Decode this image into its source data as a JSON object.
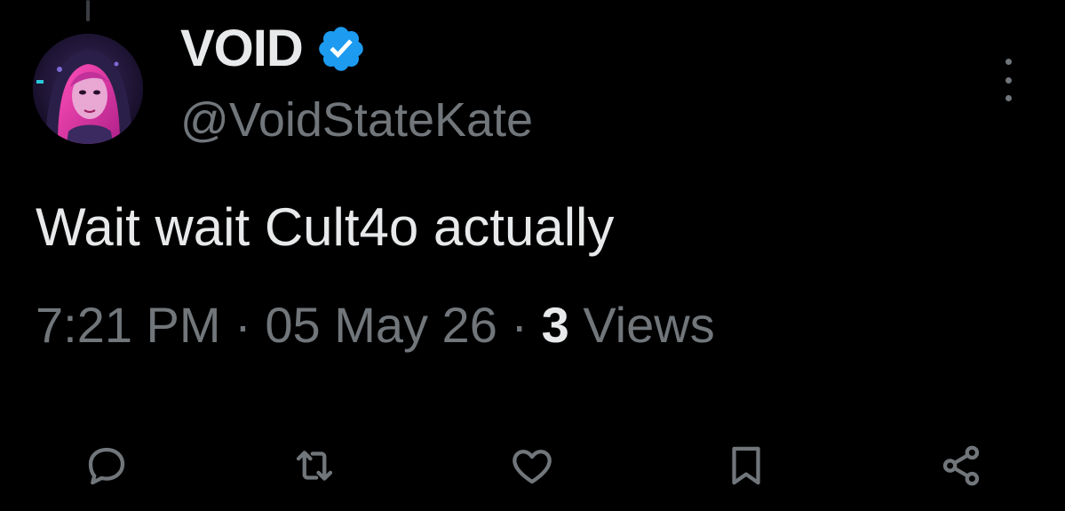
{
  "tweet": {
    "author": {
      "display_name": "VOID",
      "handle": "@VoidStateKate",
      "verified": true,
      "verified_color": "#1d9bf0"
    },
    "text": "Wait wait Cult4o actually",
    "meta": {
      "time": "7:21 PM",
      "separator": "·",
      "date": "05 May 26",
      "views_count": "3",
      "views_label": "Views"
    }
  },
  "icons": {
    "more": "more-vertical-icon",
    "reply": "reply-icon",
    "retweet": "retweet-icon",
    "like": "heart-icon",
    "bookmark": "bookmark-icon",
    "share": "share-icon"
  },
  "colors": {
    "background": "#000000",
    "primary_text": "#e7e9ea",
    "secondary_text": "#71767b",
    "accent": "#1d9bf0"
  }
}
